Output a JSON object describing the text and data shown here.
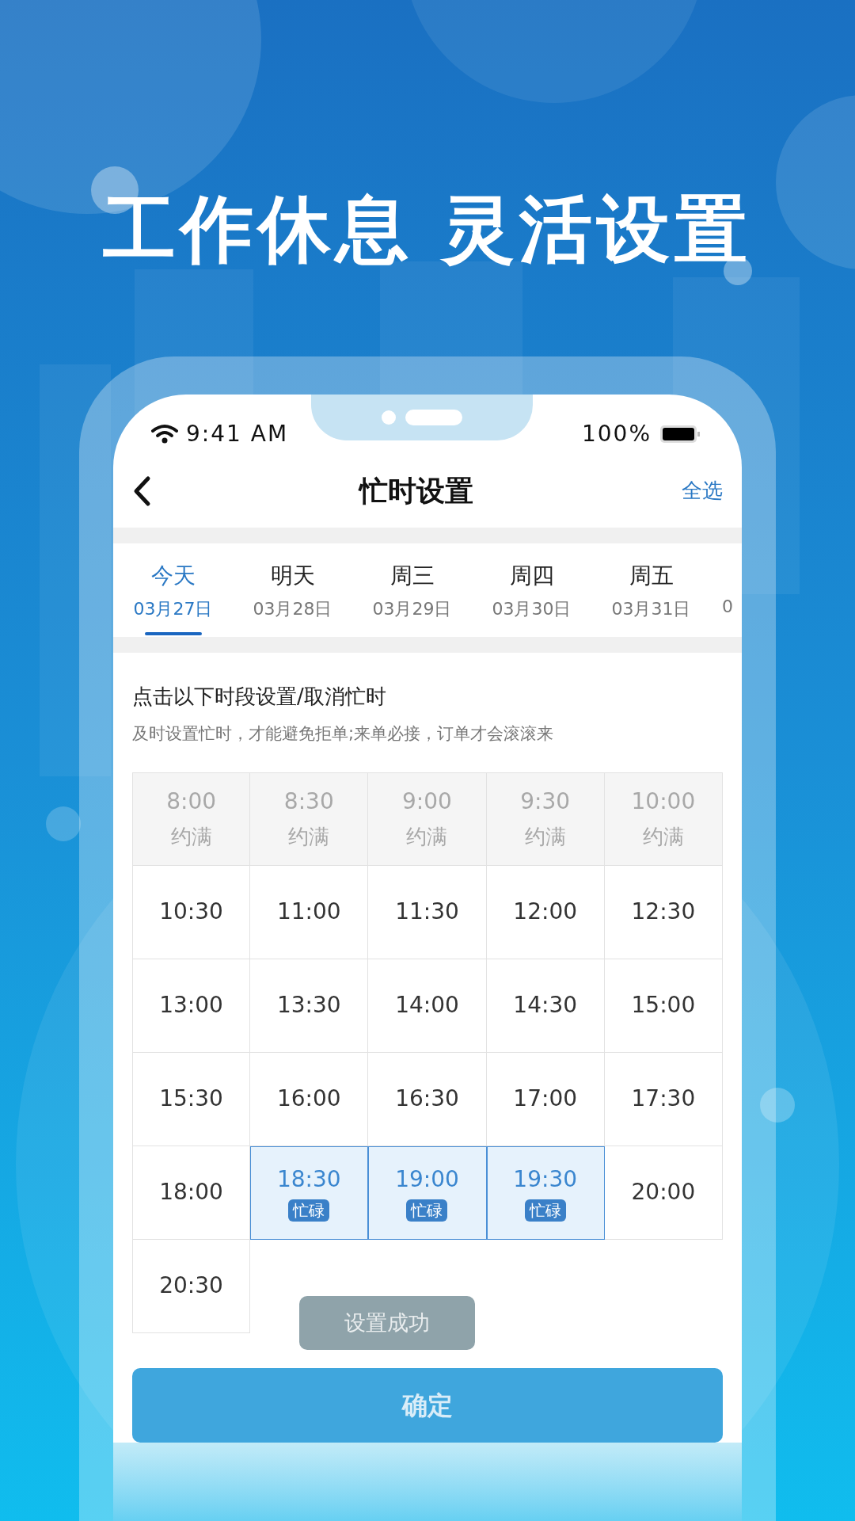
{
  "headline": [
    "工作休息",
    "灵活设置"
  ],
  "status_bar": {
    "time": "9:41 AM",
    "battery": "100%"
  },
  "nav": {
    "title": "忙时设置",
    "action": "全选"
  },
  "tabs": [
    {
      "day": "今天",
      "date": "03月27日",
      "selected": true
    },
    {
      "day": "明天",
      "date": "03月28日",
      "selected": false
    },
    {
      "day": "周三",
      "date": "03月29日",
      "selected": false
    },
    {
      "day": "周四",
      "date": "03月30日",
      "selected": false
    },
    {
      "day": "周五",
      "date": "03月31日",
      "selected": false
    },
    {
      "date": "0",
      "selected": false
    }
  ],
  "hint": {
    "title": "点击以下时段设置/取消忙时",
    "subtitle": "及时设置忙时，才能避免拒单;来单必接，订单才会滚滚来"
  },
  "slots": [
    {
      "time": "8:00",
      "kind": "full",
      "tag": "约满"
    },
    {
      "time": "8:30",
      "kind": "full",
      "tag": "约满"
    },
    {
      "time": "9:00",
      "kind": "full",
      "tag": "约满"
    },
    {
      "time": "9:30",
      "kind": "full",
      "tag": "约满"
    },
    {
      "time": "10:00",
      "kind": "full",
      "tag": "约满"
    },
    {
      "time": "10:30",
      "kind": "free"
    },
    {
      "time": "11:00",
      "kind": "free"
    },
    {
      "time": "11:30",
      "kind": "free"
    },
    {
      "time": "12:00",
      "kind": "free"
    },
    {
      "time": "12:30",
      "kind": "free"
    },
    {
      "time": "13:00",
      "kind": "free"
    },
    {
      "time": "13:30",
      "kind": "free"
    },
    {
      "time": "14:00",
      "kind": "free"
    },
    {
      "time": "14:30",
      "kind": "free"
    },
    {
      "time": "15:00",
      "kind": "free"
    },
    {
      "time": "15:30",
      "kind": "free"
    },
    {
      "time": "16:00",
      "kind": "free"
    },
    {
      "time": "16:30",
      "kind": "free"
    },
    {
      "time": "17:00",
      "kind": "free"
    },
    {
      "time": "17:30",
      "kind": "free"
    },
    {
      "time": "18:00",
      "kind": "free"
    },
    {
      "time": "18:30",
      "kind": "busy",
      "tag": "忙碌"
    },
    {
      "time": "19:00",
      "kind": "busy",
      "tag": "忙碌"
    },
    {
      "time": "19:30",
      "kind": "busy",
      "tag": "忙碌"
    },
    {
      "time": "20:00",
      "kind": "free"
    },
    {
      "time": "20:30",
      "kind": "free"
    }
  ],
  "toast": "设置成功",
  "confirm_button": "确定"
}
